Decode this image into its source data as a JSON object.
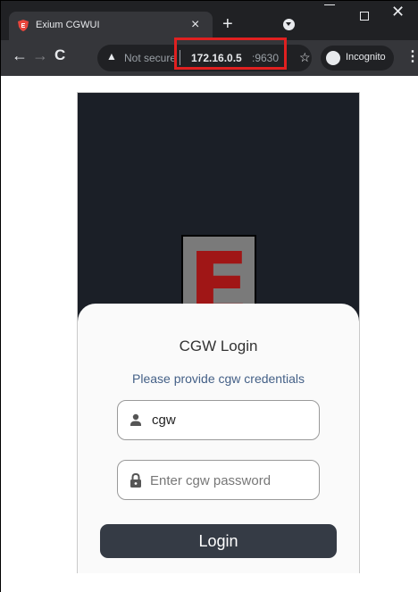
{
  "browser": {
    "tab_title": "Exium CGWUI",
    "tab_close_glyph": "×",
    "new_tab_glyph": "+",
    "minimize_icon": "minimize-icon",
    "maximize_icon": "maximize-icon",
    "close_glyph": "✕",
    "back_glyph": "←",
    "forward_glyph": "→",
    "reload_glyph": "C",
    "warning_glyph": "▲",
    "security_label": "Not secure",
    "url_host": "172.16.0.5",
    "url_port": ":9630",
    "star_glyph": "☆",
    "incognito_label": "Incognito",
    "menu_glyph": "⋮",
    "highlight_color": "#e02020"
  },
  "app": {
    "logo_letter": "E",
    "logo_color": "#a01616",
    "hero_color": "#1b1f27",
    "login": {
      "title": "CGW Login",
      "subtitle": "Please provide cgw credentials",
      "username_value": "cgw",
      "password_placeholder": "Enter cgw password",
      "button_label": "Login",
      "button_color": "#353b45"
    }
  }
}
